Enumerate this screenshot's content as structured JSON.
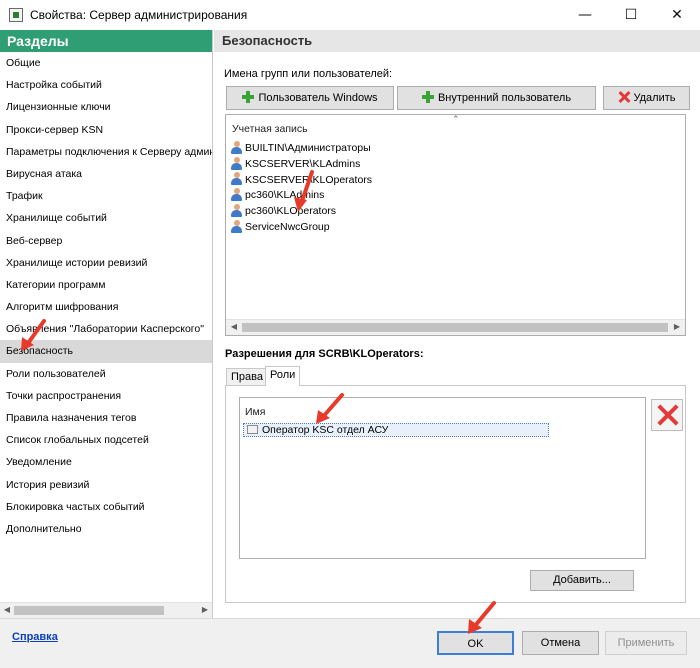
{
  "window": {
    "title": "Свойства: Сервер администрирования",
    "minimize_glyph": "—",
    "maximize_glyph": "☐",
    "close_glyph": "✕"
  },
  "sidebar": {
    "header": "Разделы",
    "items": [
      {
        "label": "Общие"
      },
      {
        "label": "Настройка событий"
      },
      {
        "label": "Лицензионные ключи"
      },
      {
        "label": "Прокси-сервер KSN"
      },
      {
        "label": "Параметры подключения к Серверу администрирования"
      },
      {
        "label": "Вирусная атака"
      },
      {
        "label": "Трафик"
      },
      {
        "label": "Хранилище событий"
      },
      {
        "label": "Веб-сервер"
      },
      {
        "label": "Хранилище истории ревизий"
      },
      {
        "label": "Категории программ"
      },
      {
        "label": "Алгоритм шифрования"
      },
      {
        "label": "Объявления \"Лаборатории Касперского\""
      },
      {
        "label": "Безопасность",
        "selected": true
      },
      {
        "label": "Роли пользователей"
      },
      {
        "label": "Точки распространения"
      },
      {
        "label": "Правила назначения тегов"
      },
      {
        "label": "Список глобальных подсетей"
      },
      {
        "label": "Уведомление"
      },
      {
        "label": "История ревизий"
      },
      {
        "label": "Блокировка частых событий"
      },
      {
        "label": "Дополнительно"
      }
    ]
  },
  "security": {
    "header": "Безопасность",
    "groups_label": "Имена групп или пользователей:",
    "buttons": {
      "windows_user": "Пользователь Windows",
      "internal_user": "Внутренний пользователь",
      "delete": "Удалить"
    },
    "account_column": "Учетная запись",
    "accounts": [
      {
        "name": "BUILTIN\\Администраторы"
      },
      {
        "name": "KSCSERVER\\KLAdmins"
      },
      {
        "name": "KSCSERVER\\KLOperators"
      },
      {
        "name": "pc360\\KLAdmins"
      },
      {
        "name": "pc360\\KLOperators"
      },
      {
        "name": "ServiceNwcGroup"
      }
    ],
    "permissions_label": "Разрешения для SCRB\\KLOperators:",
    "tabs": [
      {
        "label": "Права",
        "active": false
      },
      {
        "label": "Роли",
        "active": true
      }
    ],
    "roles_column": "Имя",
    "roles": [
      {
        "name": "Оператор KSC отдел АСУ"
      }
    ],
    "add_button": "Добавить..."
  },
  "footer": {
    "help": "Справка",
    "ok": "OK",
    "cancel": "Отмена",
    "apply": "Применить"
  },
  "colors": {
    "sidebar_header": "#2f9e74",
    "selected_item": "#d9d9d9",
    "annotation_arrow": "#e8392a",
    "link": "#0b3fb8"
  }
}
